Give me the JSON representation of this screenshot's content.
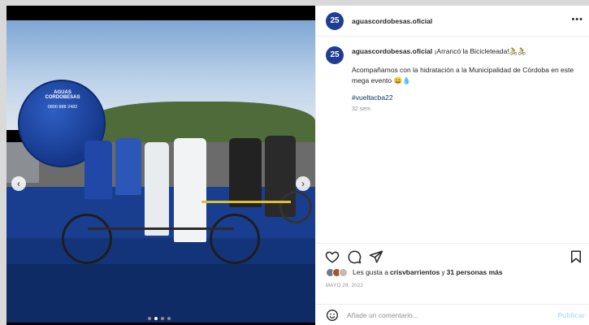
{
  "post": {
    "username": "aguascordobesas.oficial",
    "avatar_text": "25",
    "more_label": "•••",
    "caption_title": "¡Arrancó la Bicicleteada!🚴🚴",
    "caption_body": "Acompañamos con la hidratación a la Municipalidad de Córdoba en este mega evento 😀💧",
    "hashtag": "#vueltacba22",
    "time_ago": "32 sem",
    "likes_prefix": "Les gusta a ",
    "likes_user": "crisvbarrientos",
    "likes_mid": " y ",
    "likes_count": "31 personas más",
    "date": "MAYO 29, 2022",
    "comment_placeholder": "Añade un comentario...",
    "publish_label": "Publicar"
  },
  "media": {
    "globe_text": "AGUAS CORDOBESAS",
    "phone": "0800 888 2482",
    "prev_icon": "‹",
    "next_icon": "›",
    "carousel_total": 4,
    "carousel_active": 2
  },
  "icons": {
    "like": "heart-icon",
    "comment": "comment-icon",
    "share": "send-icon",
    "save": "bookmark-icon",
    "emoji": "smile-icon"
  },
  "colors": {
    "brand_blue": "#1f3e93",
    "link": "#00376b",
    "publish": "#b2dffc"
  }
}
